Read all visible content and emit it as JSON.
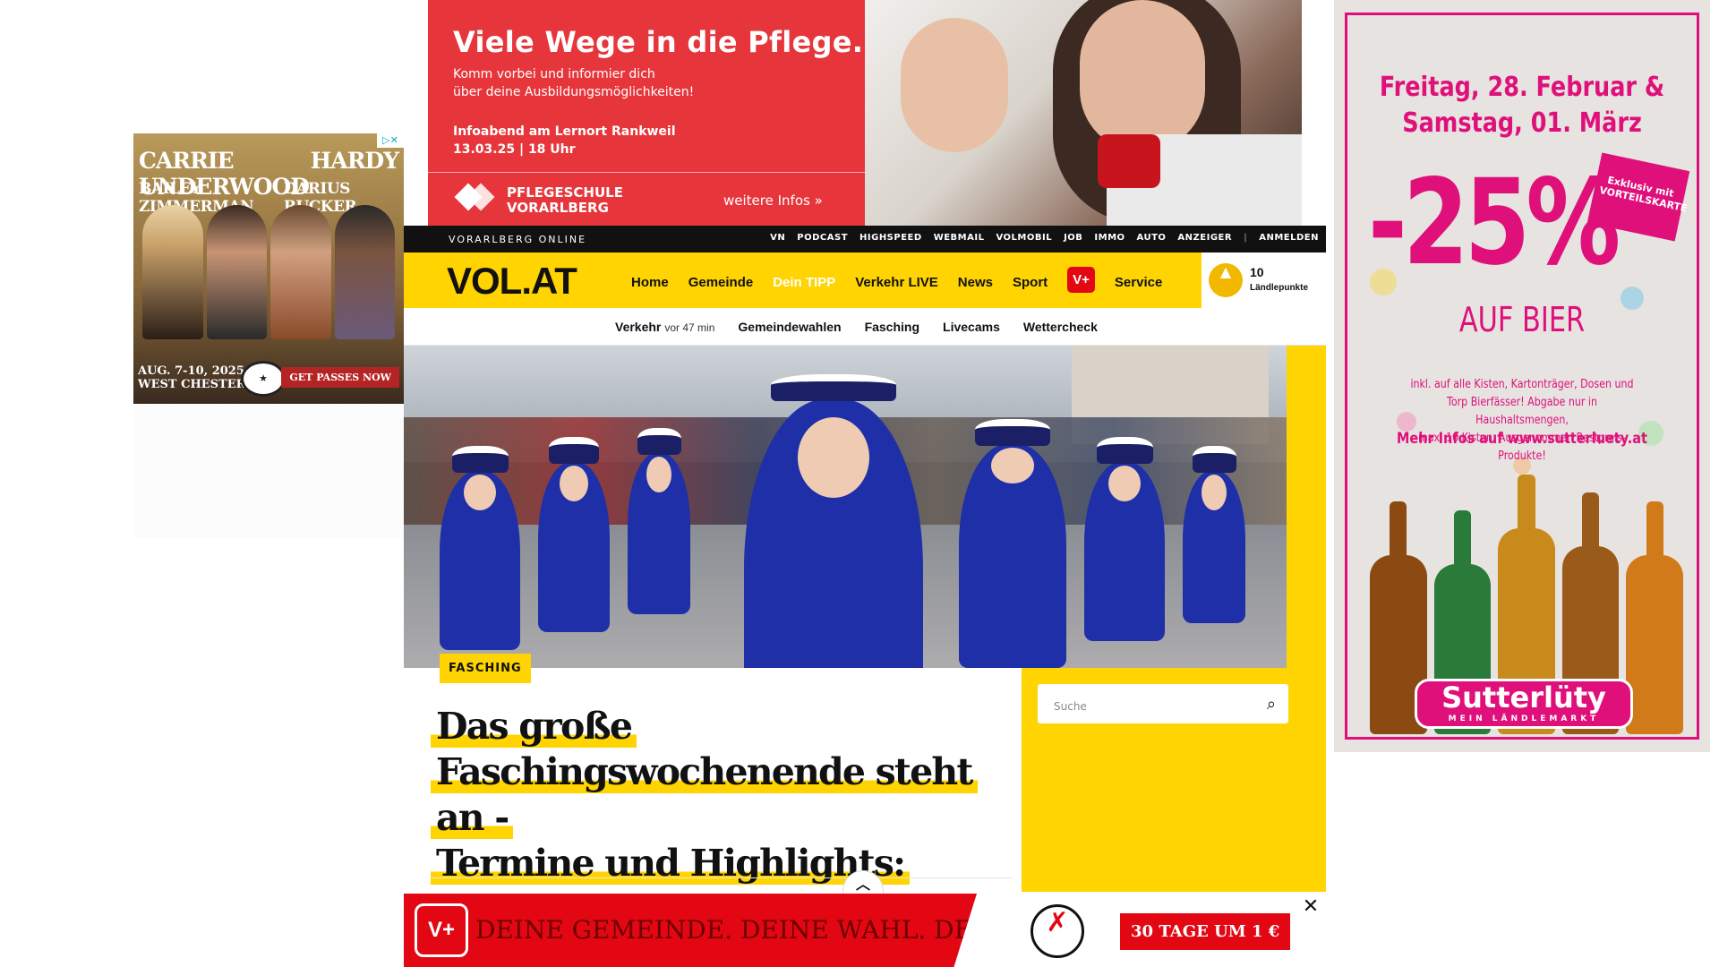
{
  "left_ad": {
    "headline_line1_left": "CARRIE UNDERWOOD",
    "headline_line1_right": "HARDY",
    "headline_line2_left": "BAILEY ZIMMERMAN",
    "headline_line2_right": "DARIUS RUCKER",
    "date_line1": "AUG. 7-10, 2025",
    "date_line2": "WEST CHESTER, OH",
    "cta": "GET PASSES NOW",
    "adchoices": "▷✕"
  },
  "top_ad": {
    "headline": "Viele Wege in die Pflege.",
    "sub_line1": "Komm vorbei und informier dich",
    "sub_line2": "über deine Ausbildungsmöglichkeiten!",
    "info_line1": "Infoabend am Lernort Rankweil",
    "info_line2": "13.03.25 | 18 Uhr",
    "logo_line1": "PFLEGESCHULE",
    "logo_line2": "VORARLBERG",
    "more": "weitere Infos »"
  },
  "right_ad": {
    "date_line1": "Freitag, 28. Februar &",
    "date_line2": "Samstag, 01. März",
    "discount": "-25%",
    "badge": "Exklusiv mit VORTEILSKARTE",
    "product": "AUF BIER",
    "small_line1": "inkl. auf alle Kisten, Kartonträger, Dosen und",
    "small_line2": "Torp Bierfässer! Abgabe nur in Haushaltsmengen,",
    "small_line3": "max. 10 Kisten. Ausgenommen Bestpreis-Produkte!",
    "more": "Mehr Infos auf www.sutterluety.at",
    "brand": "Sutterlüty",
    "brand_sub": "MEIN LÄNDLEMARKT"
  },
  "topbar": {
    "brand": "VORARLBERG ONLINE",
    "links": [
      "VN",
      "PODCAST",
      "HIGHSPEED",
      "WEBMAIL",
      "VOLMOBIL",
      "JOB",
      "IMMO",
      "AUTO",
      "ANZEIGER",
      "ANMELDEN"
    ]
  },
  "mainnav": {
    "logo": "VOL.AT",
    "items": [
      "Home",
      "Gemeinde",
      "Dein TIPP",
      "Verkehr LIVE",
      "News",
      "Sport"
    ],
    "vplus": "V+",
    "service": "Service",
    "points_value": "10",
    "points_label": "Ländlepunkte"
  },
  "subnav": {
    "verkehr": "Verkehr",
    "verkehr_time": "vor 47 min",
    "items": [
      "Gemeindewahlen",
      "Fasching",
      "Livecams",
      "Wettercheck"
    ]
  },
  "article": {
    "tag": "FASCHING",
    "title_line1": "Das große",
    "title_line2": "Faschingswochenende steht an -",
    "title_line3": "Termine und Highlights:"
  },
  "search": {
    "placeholder": "Suche"
  },
  "sticky": {
    "badge": "V+",
    "slogan": "DEINE GEMEINDE. DEINE WAHL. DEIN V",
    "cta": "30 TAGE UM 1 €",
    "close": "✕"
  },
  "colors": {
    "brand_yellow": "#ffd400",
    "accent_red": "#e30613",
    "ad_pink": "#e0107b",
    "ad_red": "#e6363b"
  }
}
